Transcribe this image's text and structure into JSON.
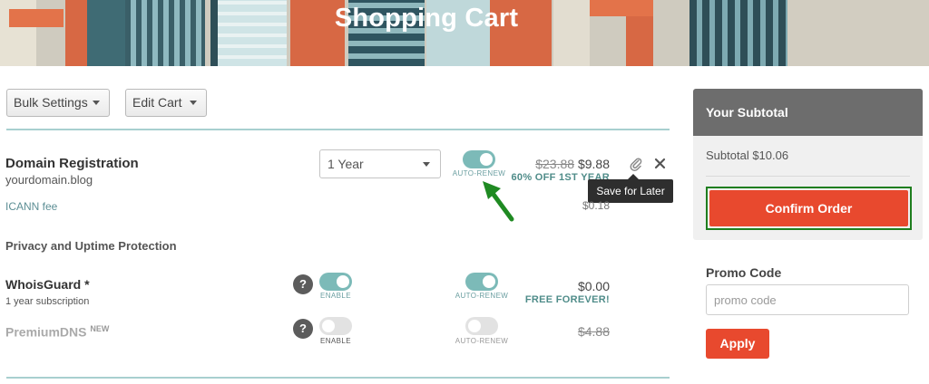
{
  "header": {
    "title": "Shopping Cart"
  },
  "toolbar": {
    "bulk_settings_label": "Bulk Settings",
    "edit_cart_label": "Edit Cart"
  },
  "cart": {
    "domain": {
      "title": "Domain Registration",
      "domain_name": "yourdomain.blog",
      "term_value": "1 Year",
      "auto_renew_label": "AUTO-RENEW",
      "auto_renew_on": true,
      "old_price": "$23.88",
      "price": "$9.88",
      "discount_text": "60% OFF 1ST YEAR",
      "icann_label": "ICANN fee",
      "icann_price": "$0.18",
      "save_for_later_tooltip": "Save for Later"
    },
    "section_heading": "Privacy and Uptime Protection",
    "whoisguard": {
      "title": "WhoisGuard *",
      "subtitle": "1 year subscription",
      "help_label": "?",
      "enable_label": "ENABLE",
      "enabled": true,
      "auto_renew_label": "AUTO-RENEW",
      "auto_renew_on": true,
      "price": "$0.00",
      "promo_text": "FREE FOREVER!"
    },
    "premiumdns": {
      "title": "PremiumDNS",
      "badge": "NEW",
      "help_label": "?",
      "enable_label": "ENABLE",
      "enabled": false,
      "auto_renew_label": "AUTO-RENEW",
      "auto_renew_on": false,
      "price": "$4.88"
    }
  },
  "summary": {
    "heading": "Your Subtotal",
    "subtotal_text": "Subtotal $10.06",
    "confirm_label": "Confirm Order",
    "promo_heading": "Promo Code",
    "promo_placeholder": "promo code",
    "apply_label": "Apply"
  },
  "colors": {
    "accent_orange": "#e8492e",
    "toggle_on": "#7cbab8",
    "divider_teal": "#a8cfcf",
    "highlight_green": "#1f7e1f",
    "panel_header": "#6d6d6d"
  },
  "icons": [
    "paperclip-icon",
    "close-icon",
    "question-icon",
    "caret-down-icon",
    "arrow-annotation-icon"
  ]
}
